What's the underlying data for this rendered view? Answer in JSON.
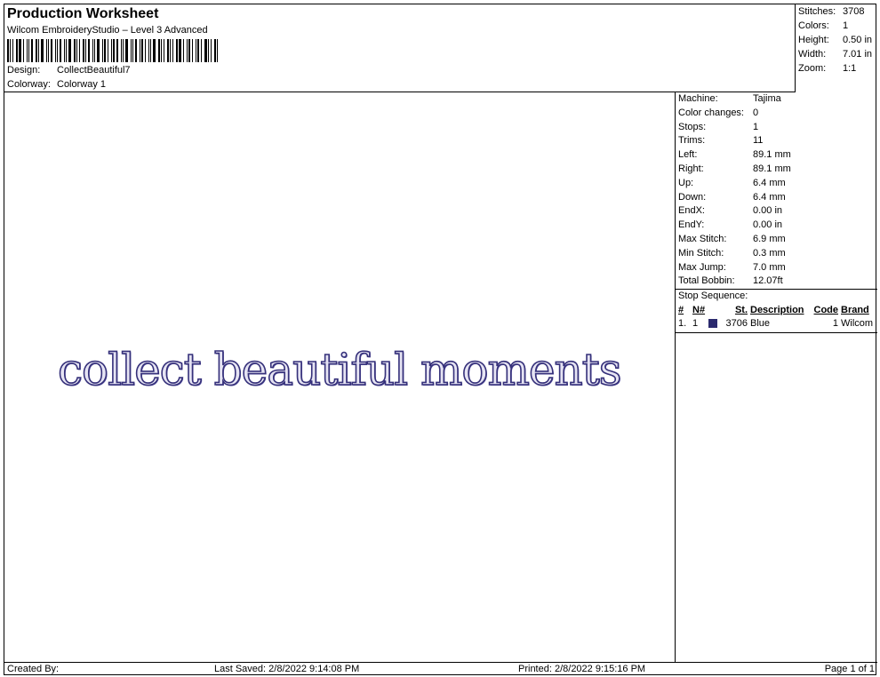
{
  "header": {
    "title": "Production Worksheet",
    "subtitle": "Wilcom EmbroideryStudio – Level 3 Advanced",
    "design_label": "Design:",
    "design_value": "CollectBeautiful7",
    "colorway_label": "Colorway:",
    "colorway_value": "Colorway 1"
  },
  "summary": [
    {
      "label": "Stitches:",
      "value": "3708"
    },
    {
      "label": "Colors:",
      "value": "1"
    },
    {
      "label": "Height:",
      "value": "0.50 in"
    },
    {
      "label": "Width:",
      "value": "7.01 in"
    },
    {
      "label": "Zoom:",
      "value": "1:1"
    }
  ],
  "design": {
    "text": "collect beautiful moments",
    "thread_color": "#35307a"
  },
  "info": [
    {
      "label": "Machine:",
      "value": "Tajima"
    },
    {
      "label": "Color changes:",
      "value": "0"
    },
    {
      "label": "Stops:",
      "value": "1"
    },
    {
      "label": "Trims:",
      "value": "11"
    },
    {
      "label": "Left:",
      "value": "89.1 mm"
    },
    {
      "label": "Right:",
      "value": "89.1 mm"
    },
    {
      "label": "Up:",
      "value": "6.4 mm"
    },
    {
      "label": "Down:",
      "value": "6.4 mm"
    },
    {
      "label": "EndX:",
      "value": "0.00 in"
    },
    {
      "label": "EndY:",
      "value": "0.00 in"
    },
    {
      "label": "Max Stitch:",
      "value": "6.9 mm"
    },
    {
      "label": "Min Stitch:",
      "value": "0.3 mm"
    },
    {
      "label": "Max Jump:",
      "value": "7.0 mm"
    },
    {
      "label": "Total Bobbin:",
      "value": "12.07ft"
    }
  ],
  "stop_sequence": {
    "title": "Stop Sequence:",
    "headers": {
      "num": "#",
      "n": "N#",
      "st": "St.",
      "description": "Description",
      "code": "Code",
      "brand": "Brand"
    },
    "rows": [
      {
        "num": "1.",
        "n": "1",
        "swatch": "#2b2a6e",
        "st": "3706",
        "description": "Blue",
        "code": "1",
        "brand": "Wilcom"
      }
    ]
  },
  "footer": {
    "created_by": "Created By:",
    "last_saved": "Last Saved: 2/8/2022 9:14:08 PM",
    "printed": "Printed: 2/8/2022 9:15:16 PM",
    "page": "Page 1 of 1"
  }
}
